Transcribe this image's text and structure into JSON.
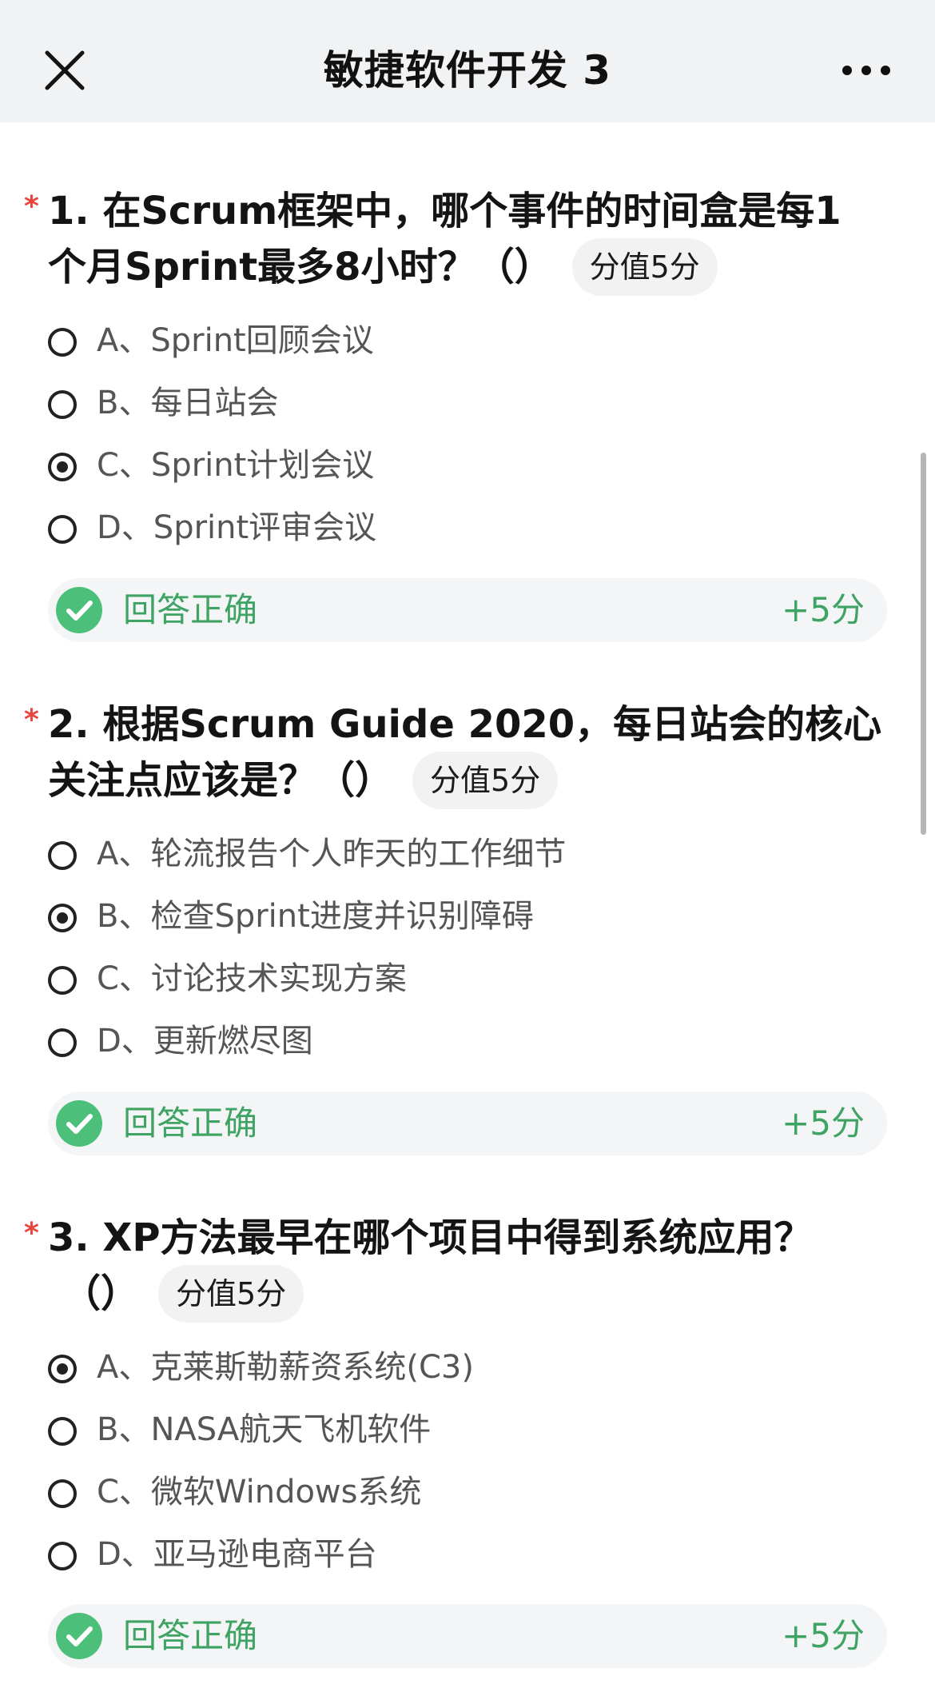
{
  "header": {
    "title": "敏捷软件开发 3",
    "close_icon": "close-icon",
    "more_icon": "more-icon"
  },
  "required_mark": "*",
  "questions": [
    {
      "lines": [
        "1. 在Scrum框架中，哪个事件的时间盒是每1",
        "个月Sprint最多8小时？（）"
      ],
      "score_label": "分值5分",
      "options": [
        {
          "label": "A、Sprint回顾会议",
          "selected": false
        },
        {
          "label": "B、每日站会",
          "selected": false
        },
        {
          "label": "C、Sprint计划会议",
          "selected": true
        },
        {
          "label": "D、Sprint评审会议",
          "selected": false
        }
      ],
      "result": {
        "text": "回答正确",
        "score": "+5分"
      }
    },
    {
      "lines": [
        "2. 根据Scrum Guide 2020，每日站会的核心",
        "关注点应该是？（）"
      ],
      "score_label": "分值5分",
      "options": [
        {
          "label": "A、轮流报告个人昨天的工作细节",
          "selected": false
        },
        {
          "label": "B、检查Sprint进度并识别障碍",
          "selected": true
        },
        {
          "label": "C、讨论技术实现方案",
          "selected": false
        },
        {
          "label": "D、更新燃尽图",
          "selected": false
        }
      ],
      "result": {
        "text": "回答正确",
        "score": "+5分"
      }
    },
    {
      "lines": [
        "3. XP方法最早在哪个项目中得到系统应用？",
        "（）"
      ],
      "score_label": "分值5分",
      "options": [
        {
          "label": "A、克莱斯勒薪资系统(C3)",
          "selected": true
        },
        {
          "label": "B、NASA航天飞机软件",
          "selected": false
        },
        {
          "label": "C、微软Windows系统",
          "selected": false
        },
        {
          "label": "D、亚马逊电商平台",
          "selected": false
        }
      ],
      "result": {
        "text": "回答正确",
        "score": "+5分"
      }
    }
  ],
  "colors": {
    "correct": "#3fa463",
    "required": "#e8453c",
    "header_bg": "#f1f2f4"
  }
}
